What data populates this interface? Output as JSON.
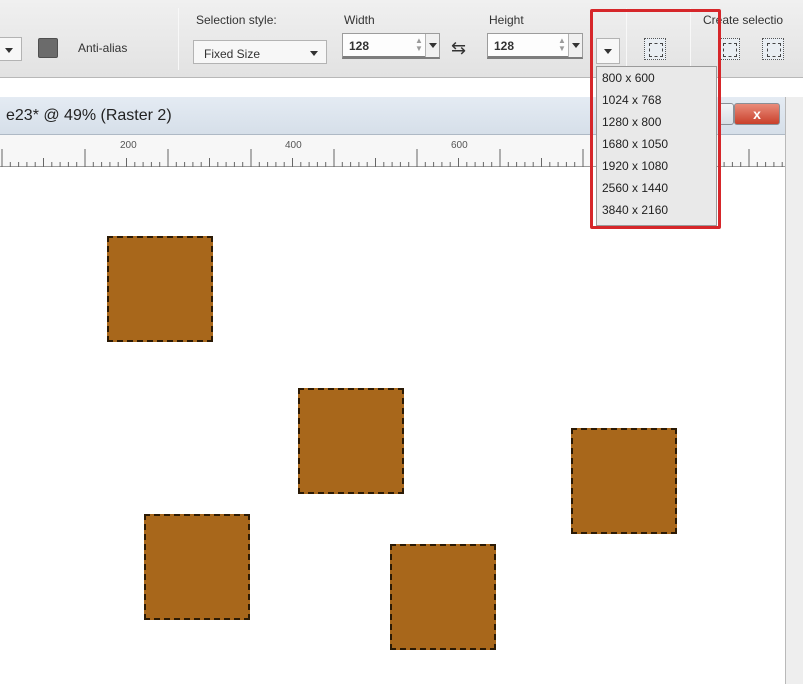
{
  "toolbar": {
    "antialias_label": "Anti-alias",
    "selection_style_label": "Selection style:",
    "selection_style_value": "Fixed Size",
    "width_label": "Width",
    "width_value": "128",
    "height_label": "Height",
    "height_value": "128",
    "create_selection_label": "Create selectio"
  },
  "document": {
    "title": "e23* @ 49% (Raster 2)",
    "close_label": "x"
  },
  "ruler": {
    "labels": [
      "200",
      "400",
      "600"
    ]
  },
  "preset_menu": {
    "items": [
      "800 x 600",
      "1024 x 768",
      "1280 x 800",
      "1680 x 1050",
      "1920 x 1080",
      "2560 x 1440",
      "3840 x 2160"
    ]
  },
  "colors": {
    "square_fill": "#a8671b",
    "highlight": "#d6262a"
  }
}
